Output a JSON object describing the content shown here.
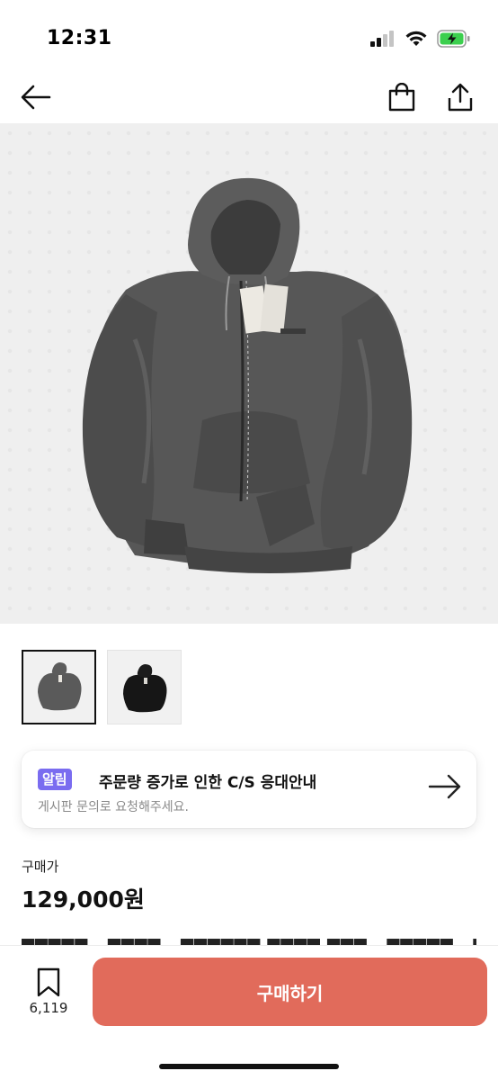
{
  "status_bar": {
    "time": "12:31"
  },
  "nav": {
    "back_icon": "arrow-left-icon",
    "bag_icon": "shopping-bag-icon",
    "share_icon": "share-icon"
  },
  "product": {
    "image_icon": "zip-hoodie-photo",
    "thumbnails": [
      {
        "icon": "gray-hoodie-thumbnail",
        "selected": true
      },
      {
        "icon": "black-hoodie-thumbnail",
        "selected": false
      }
    ]
  },
  "notice": {
    "badge": "알림",
    "title": "주문량 증가로 인한 C/S 응대안내",
    "subtitle": "게시판 문의로 요청해주세요."
  },
  "price": {
    "label": "구매가",
    "value": "129,000원"
  },
  "bottom": {
    "wish_count": "6,119",
    "buy_label": "구매하기"
  },
  "colors": {
    "accent": "#e16b5b",
    "badge": "#7a6cf0",
    "battery": "#3ccf4e"
  }
}
